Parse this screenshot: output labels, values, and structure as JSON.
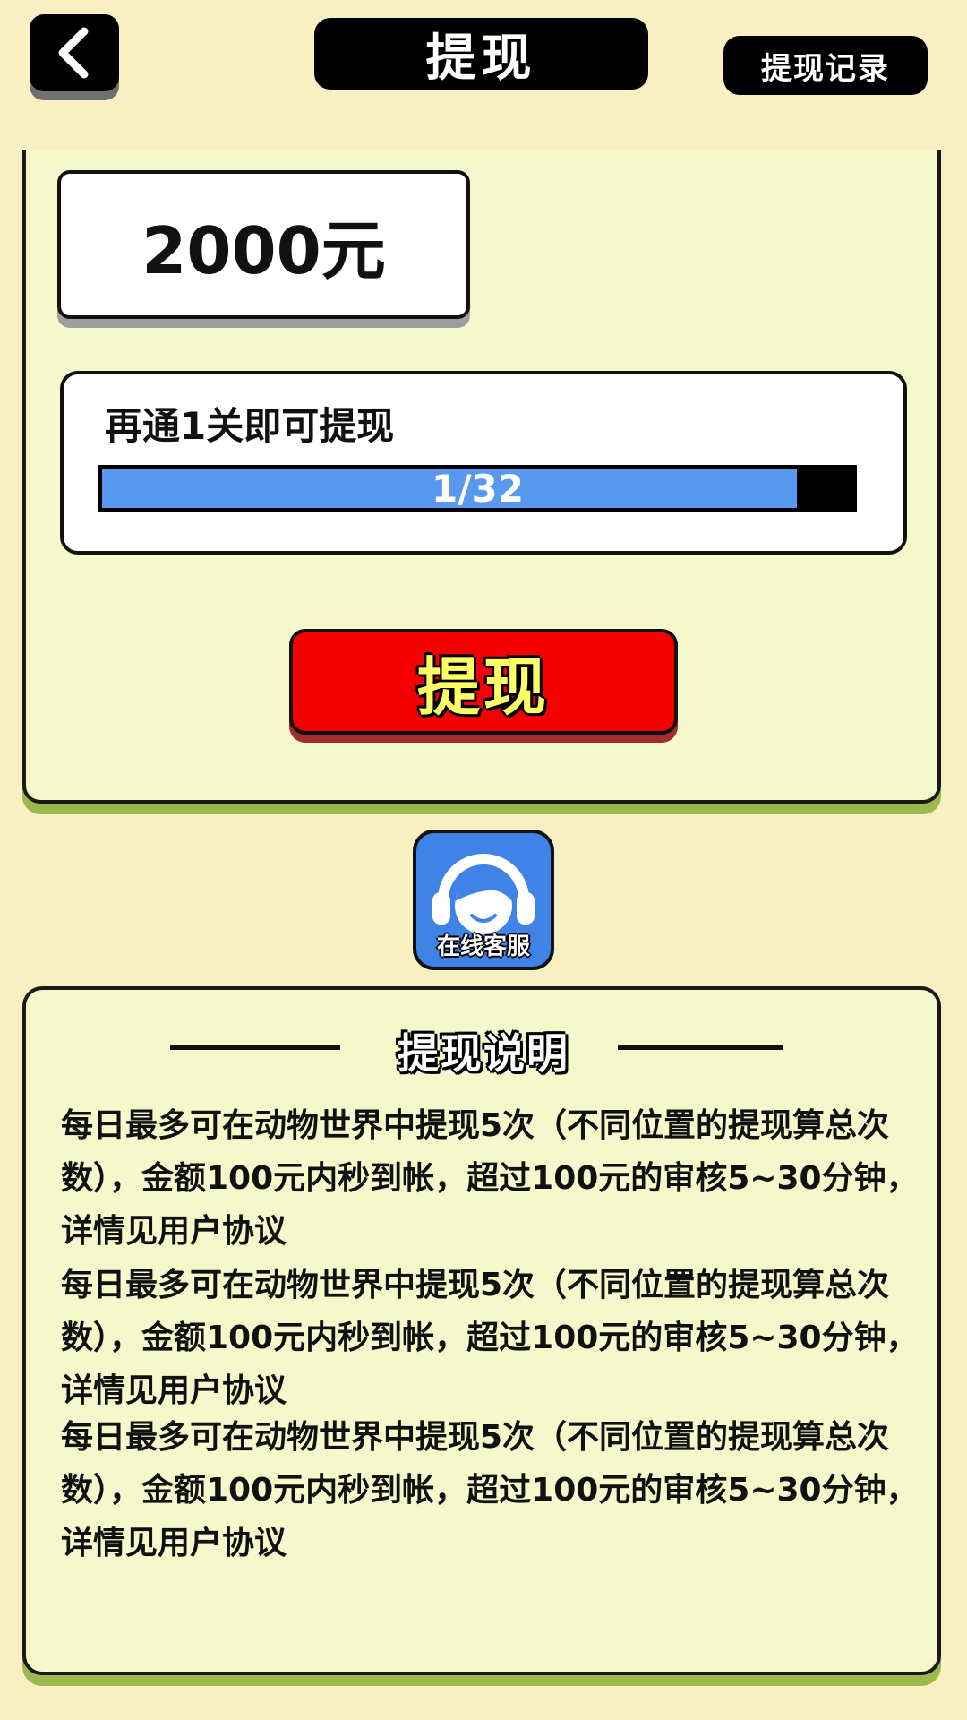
{
  "header": {
    "back_icon": "chevron-left-icon",
    "title": "提现",
    "record_label": "提现记录"
  },
  "amount": {
    "label": "2000元"
  },
  "progress": {
    "message": "再通1关即可提现",
    "label": "1/32",
    "fraction": 0.925
  },
  "withdraw_button": {
    "label": "提现"
  },
  "service": {
    "icon": "customer-service-headset-icon",
    "label": "在线客服"
  },
  "instructions": {
    "title": "提现说明",
    "paragraphs": [
      "每日最多可在动物世界中提现5次（不同位置的提现算总次数），金额100元内秒到帐，超过100元的审核5~30分钟，详情见用户协议",
      "每日最多可在动物世界中提现5次（不同位置的提现算总次数），金额100元内秒到帐，超过100元的审核5~30分钟，详情见用户协议",
      "每日最多可在动物世界中提现5次（不同位置的提现算总次数），金额100元内秒到帐，超过100元的审核5~30分钟，详情见用户协议"
    ]
  },
  "colors": {
    "background": "#f8efc2",
    "card": "#f4f8cb",
    "card_shadow": "#9cb94e",
    "progress_fill": "#5899ef",
    "withdraw_button": "#f50000",
    "withdraw_text": "#ffff66",
    "service_button": "#3f83e6"
  }
}
